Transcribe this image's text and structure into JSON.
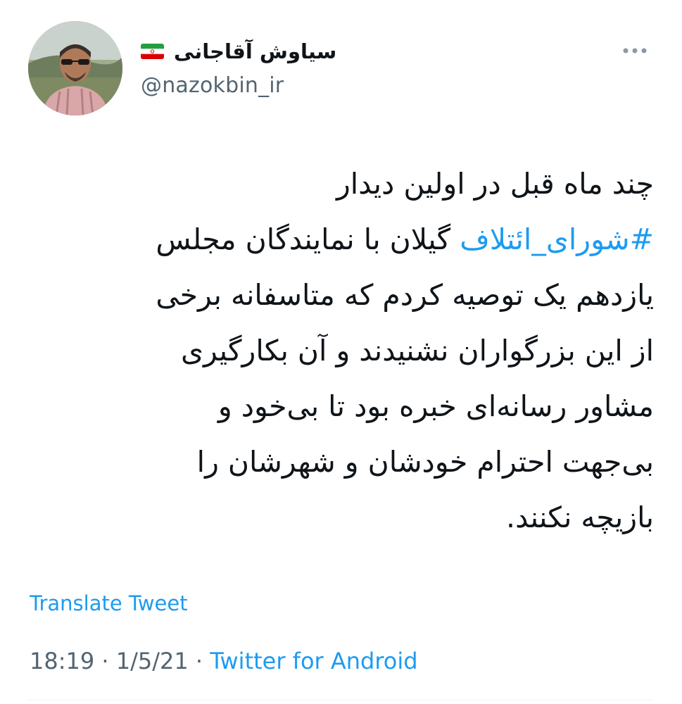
{
  "author": {
    "display_name": "سیاوش آقاجانی",
    "flag_icon": "iran-flag-icon",
    "handle": "@nazokbin_ir"
  },
  "more_icon": "more-horizontal-icon",
  "tweet": {
    "lines": [
      {
        "text": "چند ماه قبل در اولین دیدار"
      },
      {
        "hashtag": "#شورای_ائتلاف",
        "text": " گیلان با نمایندگان مجلس"
      },
      {
        "text": "یازدهم یک توصیه کردم که متاسفانه برخی"
      },
      {
        "text": "از این بزرگواران نشنیدند و آن بکارگیری"
      },
      {
        "text": "مشاور رسانه‌ای خبره بود تا بی‌خود و"
      },
      {
        "text": "بی‌جهت احترام خودشان و شهرشان را"
      },
      {
        "text": "بازیچه نکنند."
      }
    ],
    "translate_label": "Translate Tweet",
    "time": "18:19",
    "separator": "·",
    "date": "1/5/21",
    "source": "Twitter for Android"
  },
  "colors": {
    "link": "#1d9bf0",
    "secondary_text": "#536471",
    "primary_text": "#0f1419"
  }
}
